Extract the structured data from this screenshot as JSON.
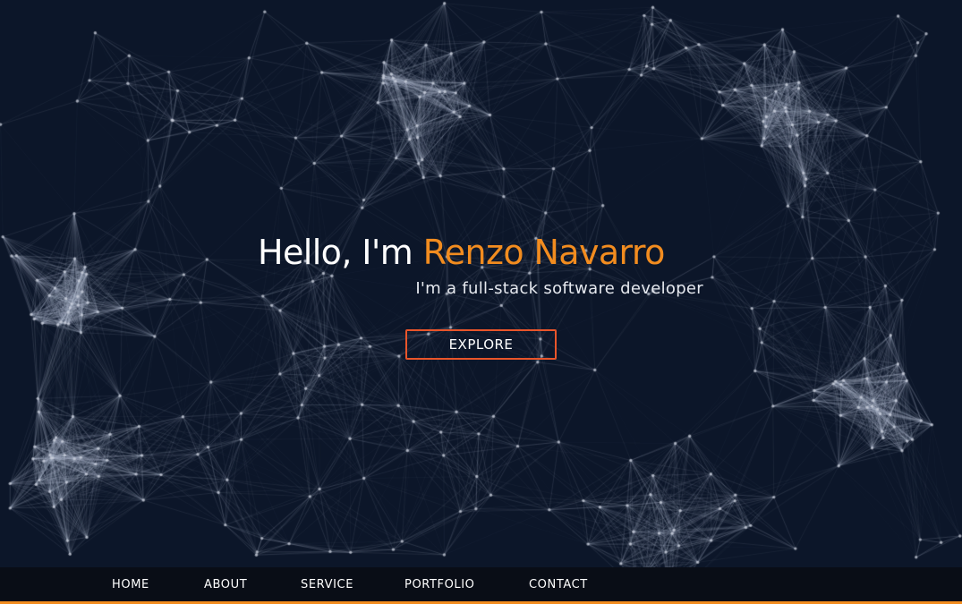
{
  "hero": {
    "greeting": "Hello, I'm ",
    "name": "Renzo Navarro",
    "tagline": "I'm a full-stack software developer",
    "cta_label": "EXPLORE"
  },
  "nav": {
    "items": [
      {
        "label": "HOME"
      },
      {
        "label": "ABOUT"
      },
      {
        "label": "SERVICE"
      },
      {
        "label": "PORTFOLIO"
      },
      {
        "label": "CONTACT"
      }
    ]
  },
  "colors": {
    "background": "#0c1629",
    "accent": "#f28c1f",
    "button_border": "#e9552a",
    "navbar": "#090d16"
  }
}
